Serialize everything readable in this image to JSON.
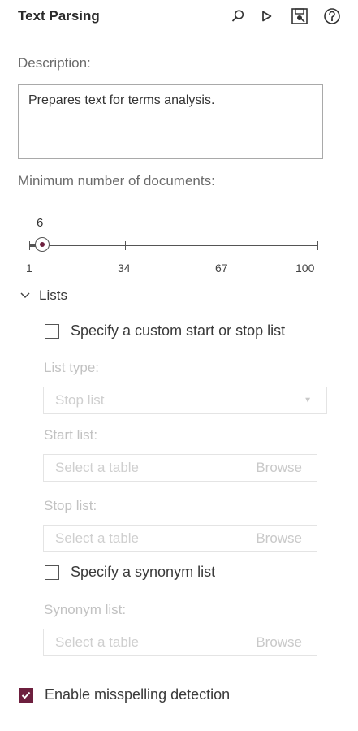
{
  "panel": {
    "title": "Text Parsing",
    "toolbar": {
      "search_icon": "search-icon",
      "run_icon": "run-icon",
      "save_icon": "save-icon",
      "help_icon": "help-icon"
    }
  },
  "description": {
    "label": "Description:",
    "value": "Prepares text for terms analysis."
  },
  "min_docs": {
    "label": "Minimum number of documents:",
    "value": "6",
    "min": 1,
    "max": 100,
    "ticks": [
      "1",
      "34",
      "67",
      "100"
    ]
  },
  "lists": {
    "section_label": "Lists",
    "expanded": true,
    "custom_list": {
      "label": "Specify a custom start or stop list",
      "checked": false
    },
    "list_type": {
      "label": "List type:",
      "value": "Stop list"
    },
    "start_list": {
      "label": "Start list:",
      "placeholder": "Select a table",
      "browse": "Browse"
    },
    "stop_list": {
      "label": "Stop list:",
      "placeholder": "Select a table",
      "browse": "Browse"
    },
    "synonym_checkbox": {
      "label": "Specify a synonym list",
      "checked": false
    },
    "synonym_list": {
      "label": "Synonym list:",
      "placeholder": "Select a table",
      "browse": "Browse"
    }
  },
  "misspelling": {
    "label": "Enable misspelling detection",
    "checked": true
  },
  "colors": {
    "accent": "#6d1f3e"
  }
}
